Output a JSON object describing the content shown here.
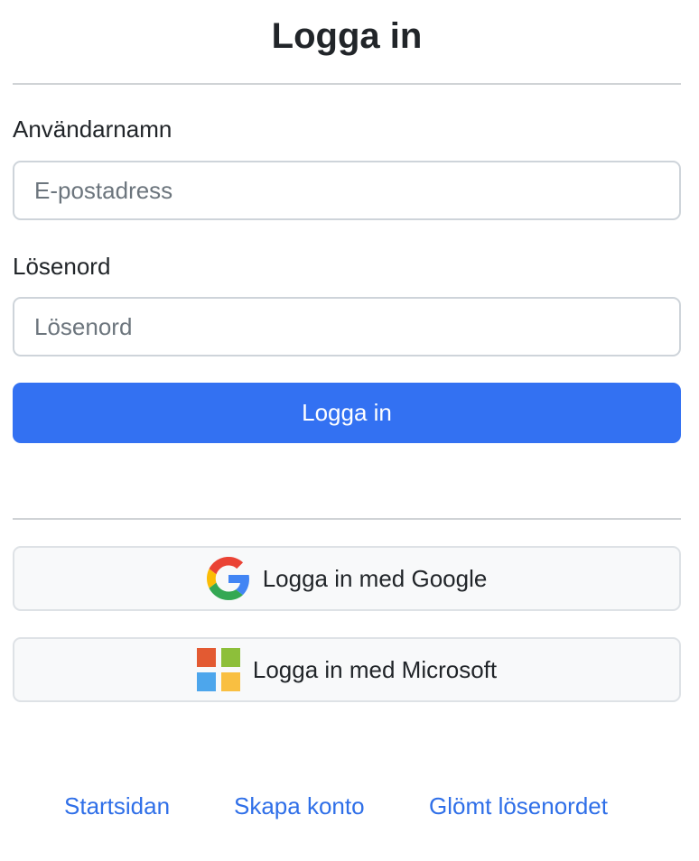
{
  "header": {
    "title": "Logga in"
  },
  "form": {
    "username_label": "Användarnamn",
    "username_placeholder": "E-postadress",
    "username_value": "",
    "password_label": "Lösenord",
    "password_placeholder": "Lösenord",
    "password_value": "",
    "submit_label": "Logga in"
  },
  "sso": {
    "google_label": "Logga in med Google",
    "google_icon": "google-logo",
    "microsoft_label": "Logga in med Microsoft",
    "microsoft_icon": "microsoft-logo"
  },
  "footer": {
    "links": [
      "Startsidan",
      "Skapa konto",
      "Glömt lösenordet"
    ]
  },
  "colors": {
    "primary": "#3371f2",
    "link": "#2f6fe8",
    "google_blue": "#4285F4",
    "google_red": "#EA4335",
    "google_yellow": "#FBBC05",
    "google_green": "#34A853",
    "ms_red": "#E35A32",
    "ms_green": "#8DBF3A",
    "ms_blue": "#4DA6EC",
    "ms_yellow": "#F9BF41"
  }
}
